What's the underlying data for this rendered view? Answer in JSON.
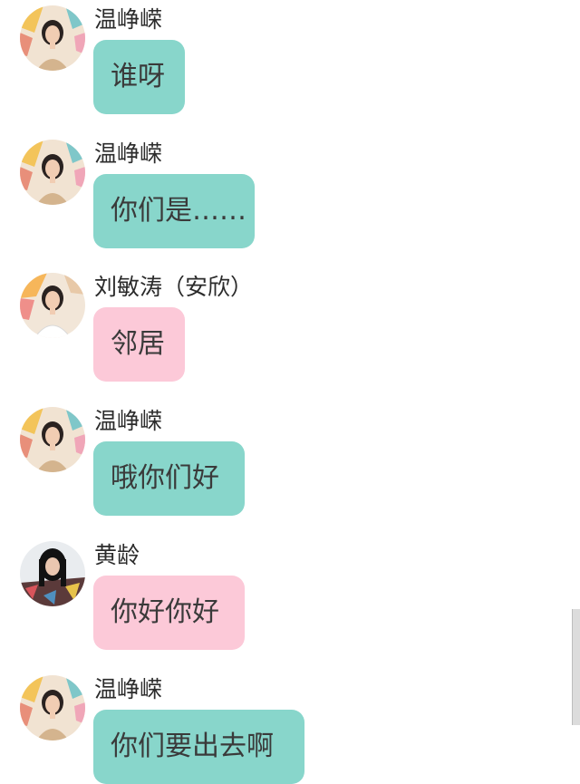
{
  "messages": [
    {
      "sender": "温峥嵘",
      "text": "谁呀",
      "bubble_color": "teal",
      "avatar": "avatar-wen-zhengrong"
    },
    {
      "sender": "温峥嵘",
      "text": "你们是……",
      "bubble_color": "teal",
      "avatar": "avatar-wen-zhengrong"
    },
    {
      "sender": "刘敏涛（安欣）",
      "text": "邻居",
      "bubble_color": "pink",
      "avatar": "avatar-liu-mintao"
    },
    {
      "sender": "温峥嵘",
      "text": "哦你们好",
      "bubble_color": "teal",
      "avatar": "avatar-wen-zhengrong"
    },
    {
      "sender": "黄龄",
      "text": "你好你好",
      "bubble_color": "pink",
      "avatar": "avatar-huang-ling"
    },
    {
      "sender": "温峥嵘",
      "text": "你们要出去啊",
      "bubble_color": "teal",
      "avatar": "avatar-wen-zhengrong"
    }
  ],
  "colors": {
    "teal_bubble": "#88d6cb",
    "pink_bubble": "#fcc9d8",
    "background": "#ffffff"
  }
}
